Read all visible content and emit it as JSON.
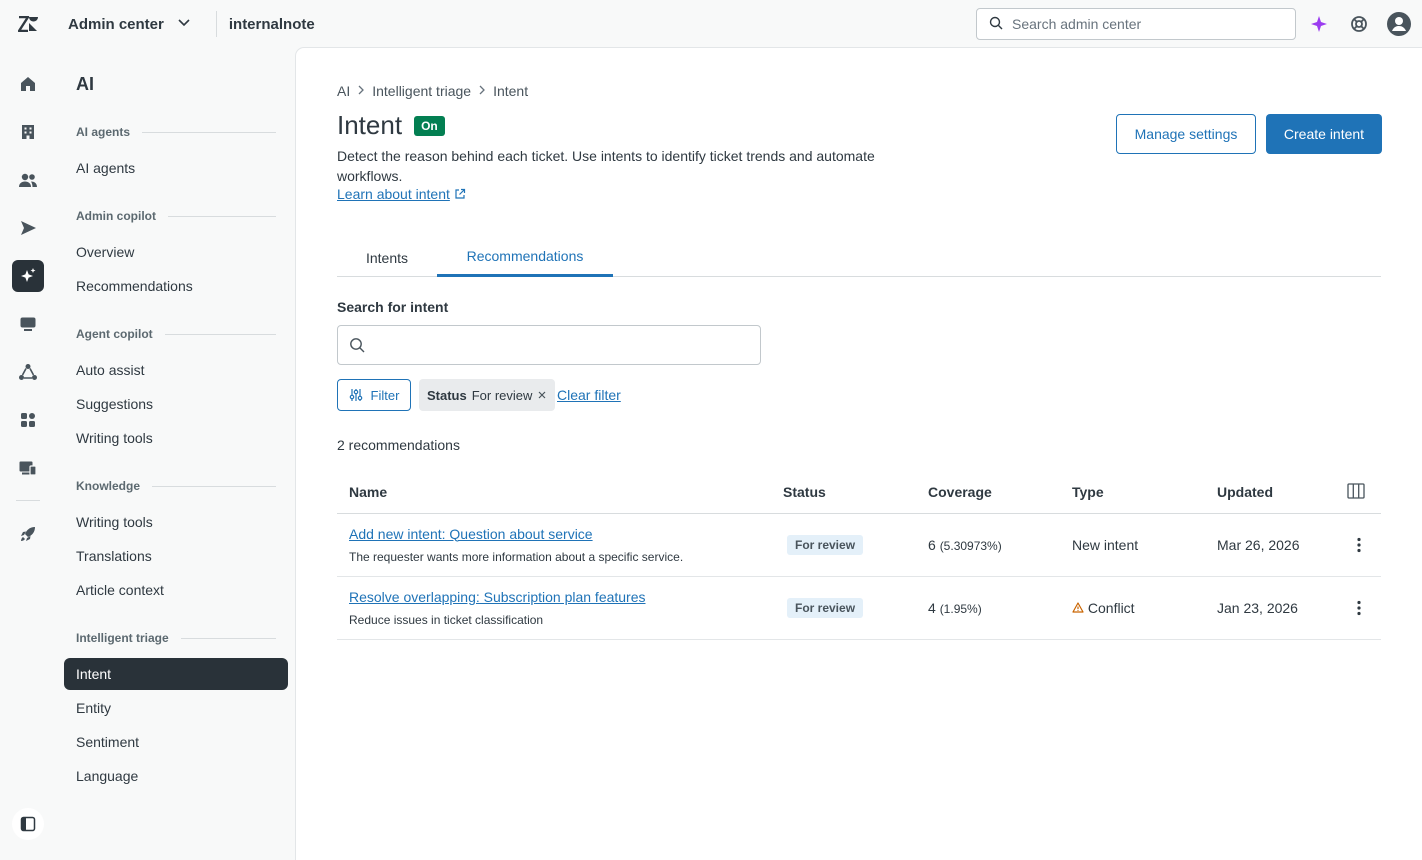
{
  "topbar": {
    "product": "Admin center",
    "account": "internalnote",
    "search_placeholder": "Search admin center"
  },
  "icons": {
    "logo": "zendesk-logo-icon",
    "rail": [
      "home-icon",
      "building-icon",
      "people-icon",
      "send-icon",
      "sparkle-icon",
      "chat-icon",
      "workflow-icon",
      "apps-icon",
      "devices-icon",
      "rocket-icon"
    ],
    "top": [
      "ai-sparkle-icon",
      "help-icon",
      "avatar-icon"
    ]
  },
  "colors": {
    "accent": "#1f73b7",
    "on_badge": "#037f52",
    "active_nav": "#293239",
    "warning": "#c96400"
  },
  "subnav": {
    "title": "AI",
    "sections": [
      {
        "heading": "AI agents",
        "items": [
          "AI agents"
        ]
      },
      {
        "heading": "Admin copilot",
        "items": [
          "Overview",
          "Recommendations"
        ]
      },
      {
        "heading": "Agent copilot",
        "items": [
          "Auto assist",
          "Suggestions",
          "Writing tools"
        ]
      },
      {
        "heading": "Knowledge",
        "items": [
          "Writing tools",
          "Translations",
          "Article context"
        ]
      },
      {
        "heading": "Intelligent triage",
        "items": [
          "Intent",
          "Entity",
          "Sentiment",
          "Language"
        ]
      }
    ]
  },
  "main": {
    "breadcrumb": [
      "AI",
      "Intelligent triage",
      "Intent"
    ],
    "title": "Intent",
    "status_badge": "On",
    "description": "Detect the reason behind each ticket. Use intents to identify ticket trends and automate workflows.",
    "learn_link": "Learn about intent",
    "manage_button": "Manage settings",
    "create_button": "Create intent",
    "tabs": [
      "Intents",
      "Recommendations"
    ],
    "search_label": "Search for intent",
    "filter_button": "Filter",
    "chip_key": "Status",
    "chip_value": "For review",
    "clear_filter": "Clear filter",
    "count": "2 recommendations",
    "table": {
      "headers": [
        "Name",
        "Status",
        "Coverage",
        "Type",
        "Updated"
      ],
      "rows": [
        {
          "title": "Add new intent: Question about service",
          "subtitle": "The requester wants more information about a specific service.",
          "status": "For review",
          "coverage": "6",
          "coverage_pct": "(5.30973%)",
          "type": "New intent",
          "updated": "Mar 26, 2026"
        },
        {
          "title": "Resolve overlapping: Subscription plan features",
          "subtitle": "Reduce issues in ticket classification",
          "status": "For review",
          "coverage": "4",
          "coverage_pct": "(1.95%)",
          "type": "Conflict",
          "updated": "Jan 23, 2026"
        }
      ]
    }
  }
}
